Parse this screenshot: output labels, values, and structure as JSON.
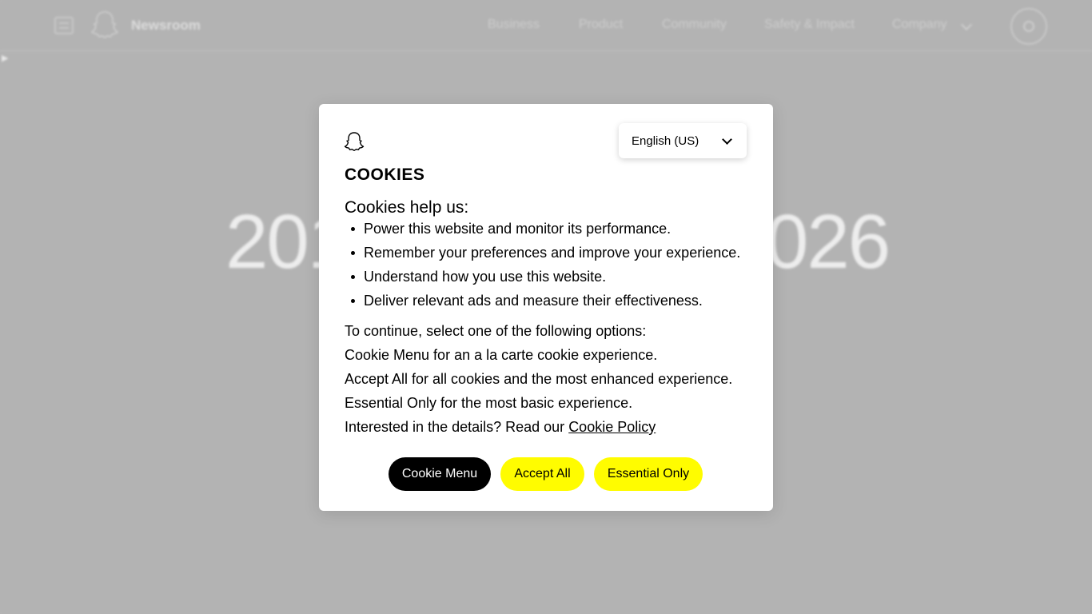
{
  "colors": {
    "overlay_bg": "#b4b4b4",
    "modal_bg": "#ffffff",
    "primary_button": "#000000",
    "accent_yellow": "#fffc00"
  },
  "background_page": {
    "brand": "Newsroom",
    "nav": [
      "Business",
      "Product",
      "Community",
      "Safety & Impact",
      "Company"
    ],
    "year_left": "201",
    "year_right": "026"
  },
  "cookie_modal": {
    "language": "English (US)",
    "title": "COOKIES",
    "subtitle": "Cookies help us:",
    "bullets": [
      "Power this website and monitor its performance.",
      "Remember your preferences and improve your experience.",
      "Understand how you use this website.",
      "Deliver relevant ads and measure their effectiveness."
    ],
    "paragraphs": [
      "To continue, select one of the following options:",
      "Cookie Menu for an a la carte cookie experience.",
      "Accept All for all cookies and the most enhanced experience.",
      "Essential Only for the most basic experience."
    ],
    "details_prefix": "Interested in the details? Read our ",
    "policy_link": "Cookie Policy",
    "buttons": {
      "menu": "Cookie Menu",
      "accept": "Accept All",
      "essential": "Essential Only"
    }
  }
}
